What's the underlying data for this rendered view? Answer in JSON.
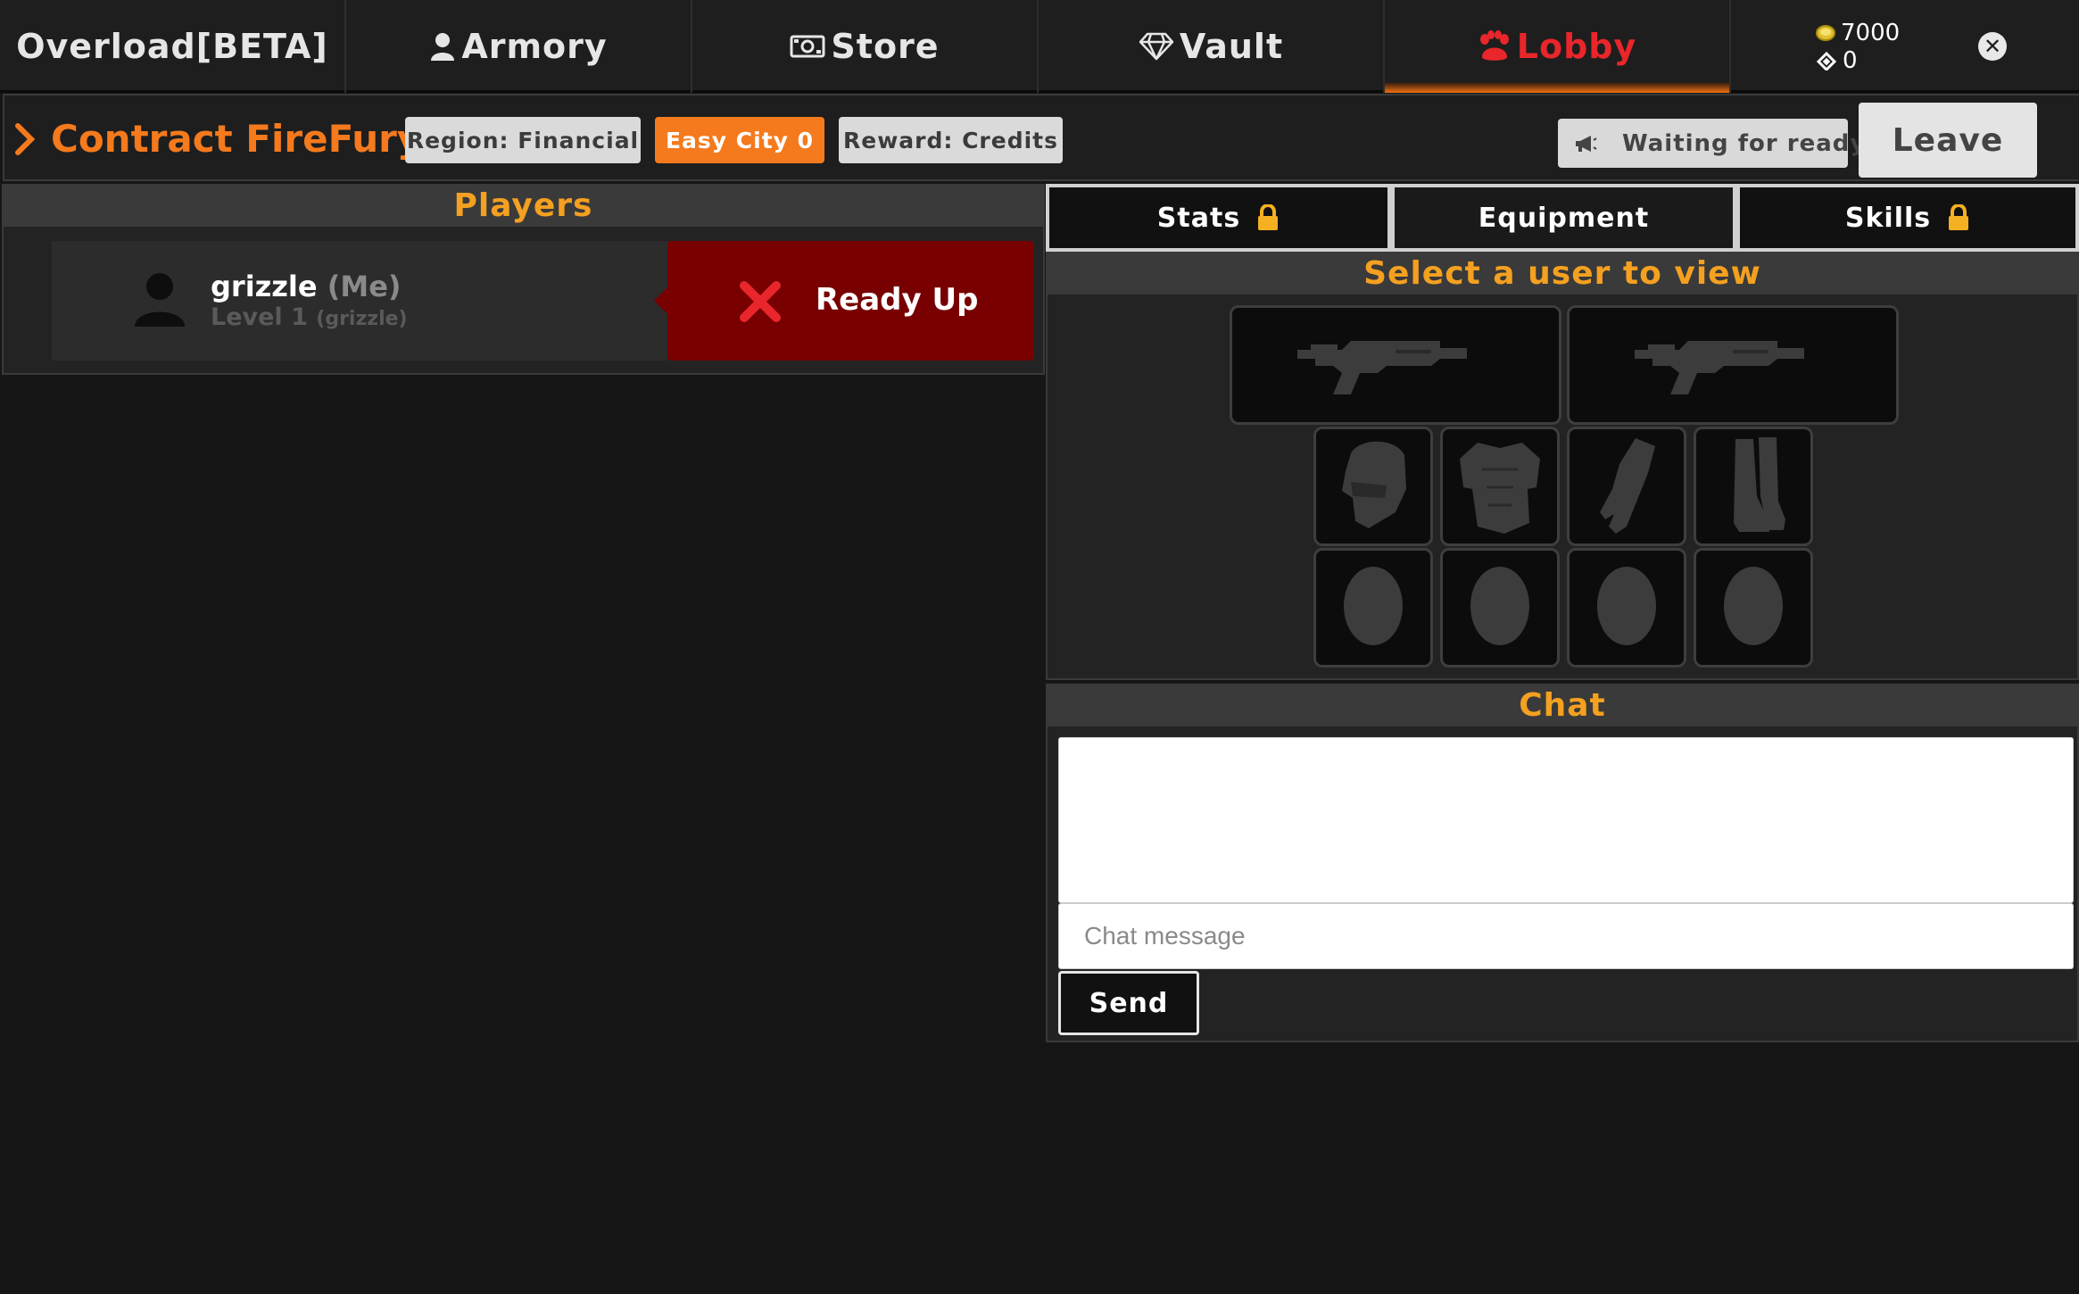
{
  "nav": {
    "tabs": [
      {
        "label": "Overload[BETA]",
        "icon": ""
      },
      {
        "label": "Armory",
        "icon": "user-icon"
      },
      {
        "label": "Store",
        "icon": "cash-icon"
      },
      {
        "label": "Vault",
        "icon": "diamond-icon"
      },
      {
        "label": "Lobby",
        "icon": "paw-icon",
        "active": true
      }
    ],
    "credits": "7000",
    "tokens": "0",
    "accent_color": "#e8262b",
    "gradient_color": "#f07010"
  },
  "contract": {
    "title": "Contract FireFury",
    "region": "Region: Financial",
    "difficulty": "Easy City 0",
    "reward": "Reward: Credits",
    "status": "Waiting for ready",
    "leave_label": "Leave",
    "title_color": "#f47a1d"
  },
  "players": {
    "heading": "Players",
    "list": [
      {
        "name": "grizzle",
        "me_tag": "(Me)",
        "level": "Level 1",
        "account": "(grizzle)"
      }
    ],
    "ready_label": "Ready Up",
    "ready_color": "#780000"
  },
  "tabs": {
    "stats": "Stats",
    "equipment": "Equipment",
    "skills": "Skills"
  },
  "equipment": {
    "heading": "Select a user to view",
    "slots": [
      "primary-weapon",
      "secondary-weapon",
      "helmet",
      "chest",
      "gloves",
      "boots",
      "module-1",
      "module-2",
      "module-3",
      "module-4"
    ]
  },
  "chat": {
    "heading": "Chat",
    "placeholder": "Chat message",
    "send_label": "Send"
  }
}
